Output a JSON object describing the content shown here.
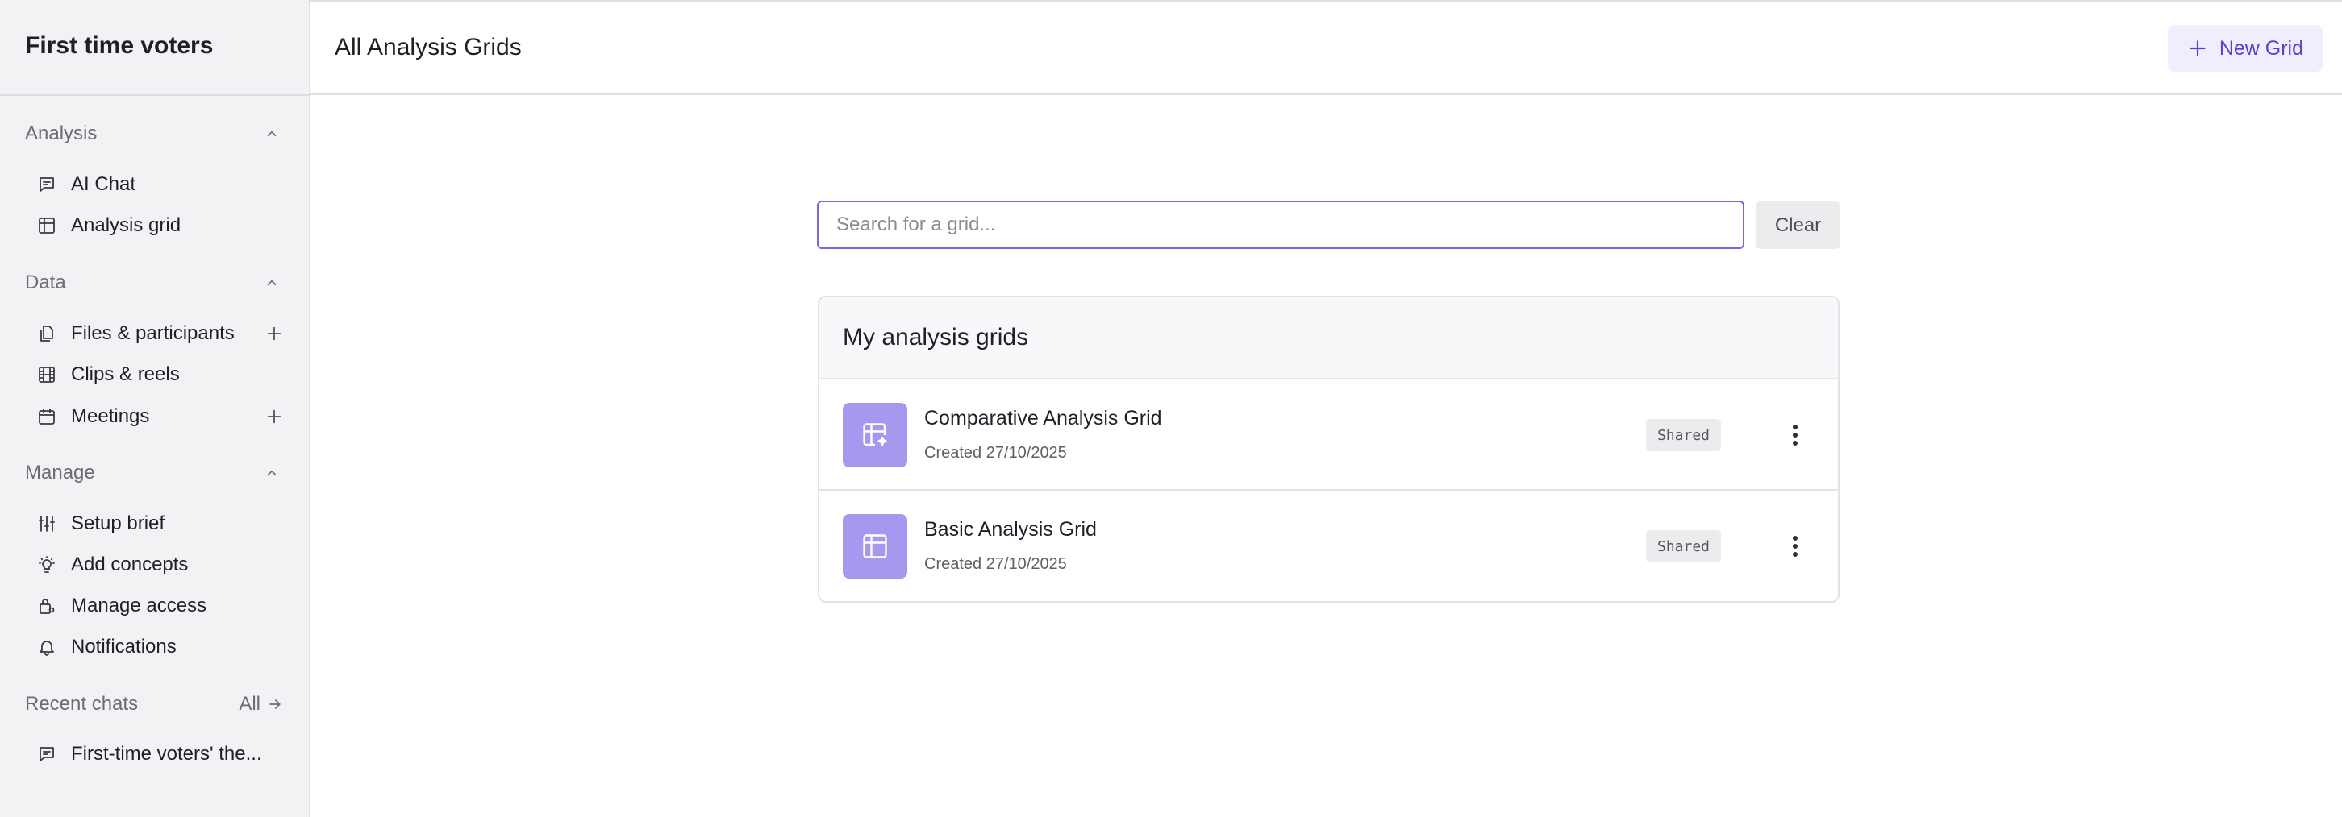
{
  "sidebar": {
    "title": "First time voters",
    "sections": {
      "analysis": "Analysis",
      "data": "Data",
      "manage": "Manage",
      "recent": "Recent chats"
    },
    "items": {
      "ai_chat": "AI Chat",
      "analysis_grid": "Analysis grid",
      "files": "Files & participants",
      "clips": "Clips & reels",
      "meetings": "Meetings",
      "setup_brief": "Setup brief",
      "add_concepts": "Add concepts",
      "manage_access": "Manage access",
      "notifications": "Notifications"
    },
    "recent_all": "All",
    "recent_chats": [
      "First-time voters' the..."
    ]
  },
  "header": {
    "title": "All Analysis Grids",
    "new_grid": "New Grid"
  },
  "search": {
    "placeholder": "Search for a grid...",
    "value": "",
    "clear": "Clear"
  },
  "grids": {
    "heading": "My analysis grids",
    "rows": [
      {
        "name": "Comparative Analysis Grid",
        "created": "Created 27/10/2025",
        "badge": "Shared",
        "icon": "table-sparkle-icon"
      },
      {
        "name": "Basic Analysis Grid",
        "created": "Created 27/10/2025",
        "badge": "Shared",
        "icon": "table-icon"
      }
    ]
  },
  "colors": {
    "accent": "#5b3fd6",
    "thumb": "#a897ef",
    "sidebar_bg": "#f2f2f4"
  }
}
